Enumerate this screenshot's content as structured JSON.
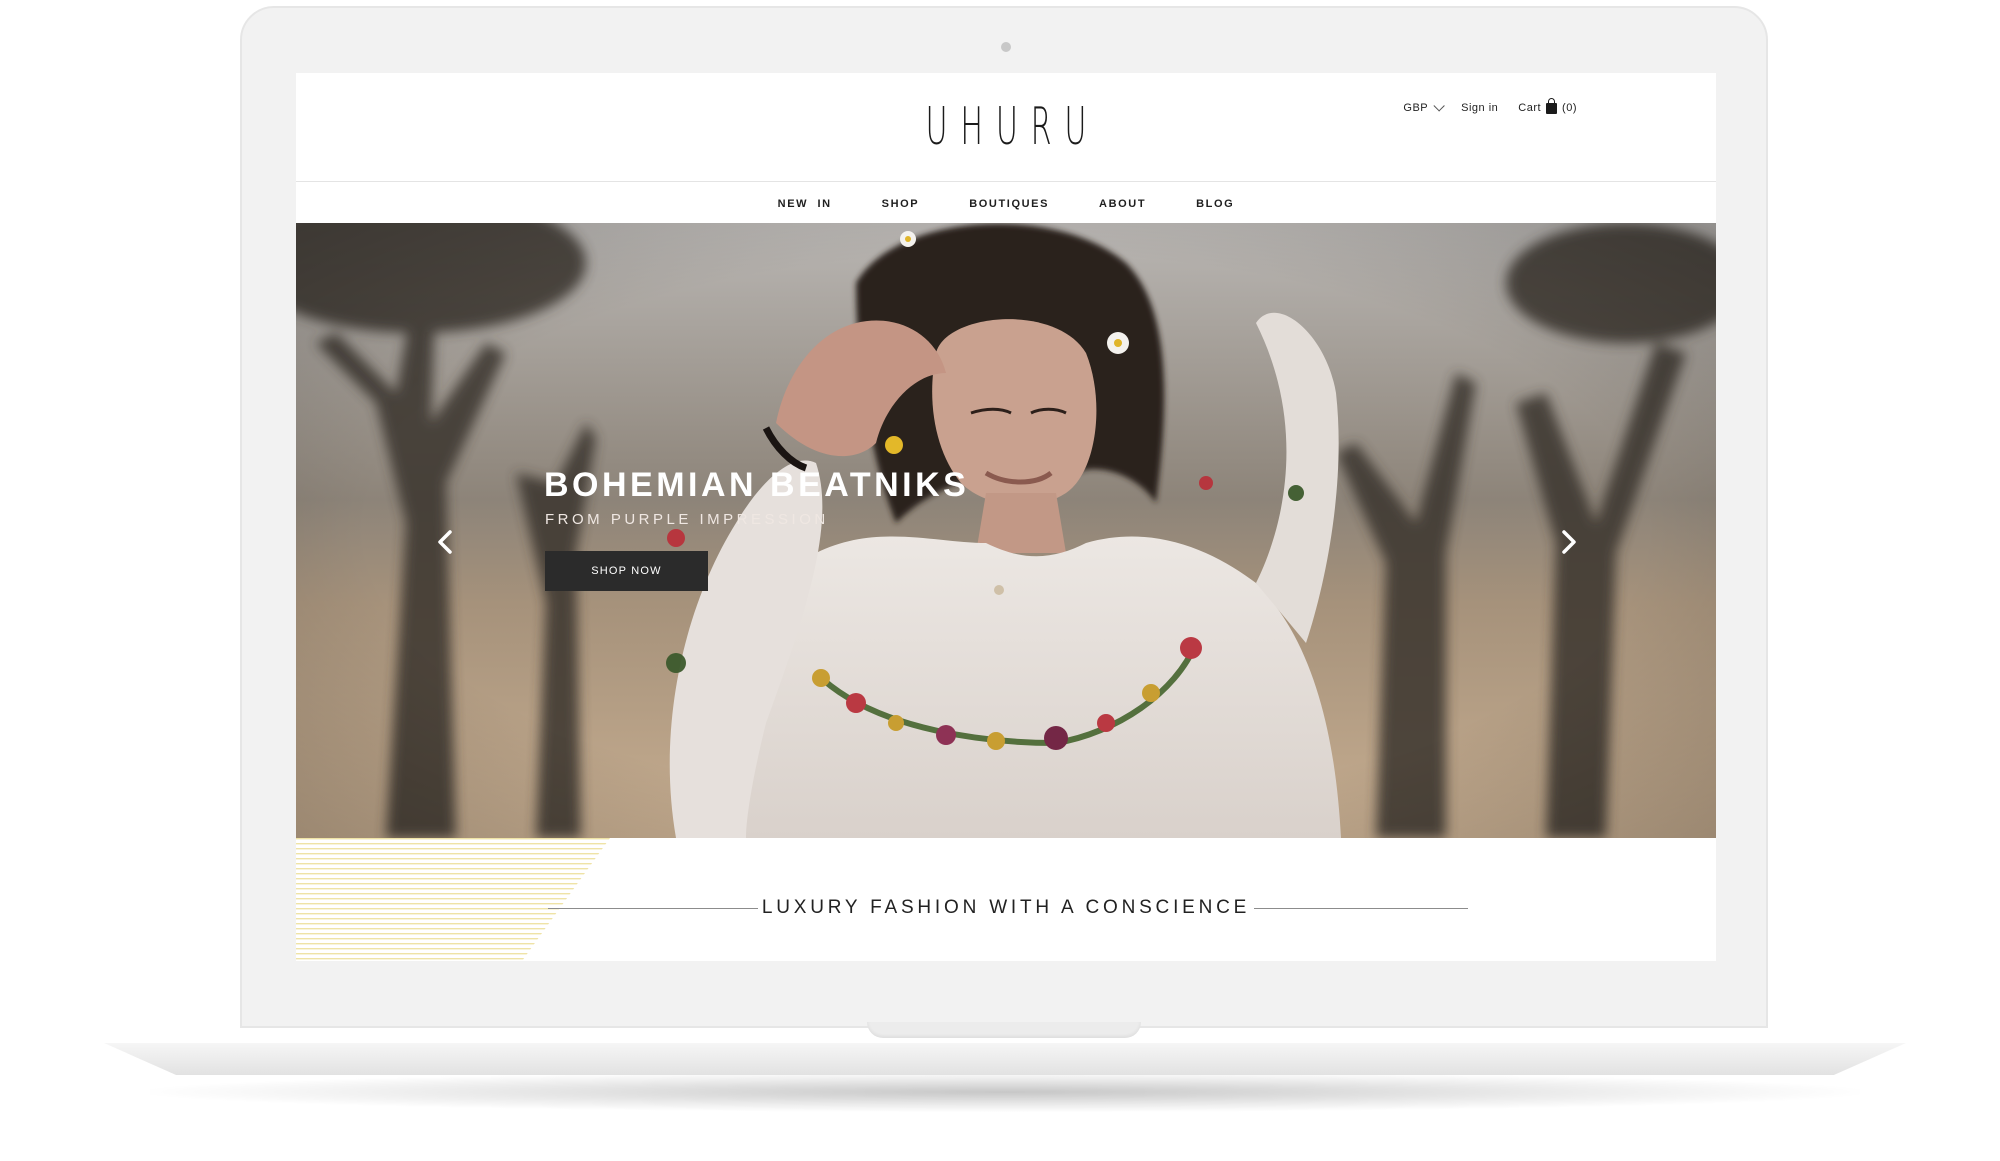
{
  "header": {
    "logo": "UHURU",
    "currency": "GBP",
    "sign_in": "Sign in",
    "cart_label": "Cart",
    "cart_count": "(0)"
  },
  "nav": {
    "items": [
      "NEW  IN",
      "SHOP",
      "BOUTIQUES",
      "ABOUT",
      "BLOG"
    ]
  },
  "hero": {
    "title": "BOHEMIAN BEATNIKS",
    "subtitle": "FROM PURPLE IMPRESSION",
    "cta": "SHOP NOW"
  },
  "tagline": "LUXURY FASHION WITH A CONSCIENCE",
  "colors": {
    "button_bg": "#2b2b2b",
    "text_dark": "#1b1b1b",
    "stripe_accent": "#efe3a6"
  },
  "icons": [
    "chevron-down-icon",
    "cart-bag-icon",
    "arrow-left-icon",
    "arrow-right-icon"
  ]
}
